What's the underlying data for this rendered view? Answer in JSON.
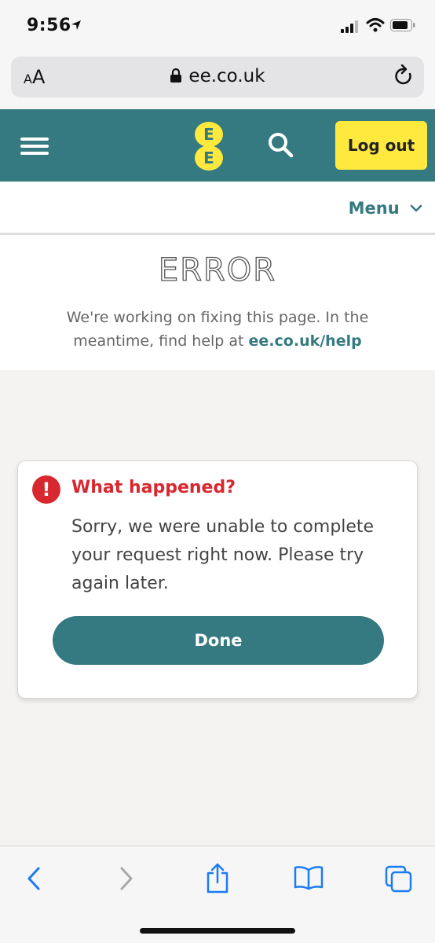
{
  "status_bar": {
    "time": "9:56"
  },
  "browser": {
    "text_size_label_big": "A",
    "text_size_label_small": "A",
    "url": "ee.co.uk"
  },
  "header": {
    "logo_letters": [
      "E",
      "E"
    ],
    "logout_label": "Log out"
  },
  "nav": {
    "menu_label": "Menu"
  },
  "error_page": {
    "title": "ERROR",
    "description_prefix": "We're working on fixing this page. In the meantime, find help at",
    "help_link": "ee.co.uk/help"
  },
  "dialog": {
    "icon_glyph": "!",
    "title": "What happened?",
    "message": "Sorry, we were unable to complete your request right now. Please try again later.",
    "done_label": "Done"
  },
  "colors": {
    "brand_teal": "#357a80",
    "brand_yellow": "#ffe93f",
    "error_red": "#d8282f",
    "ios_blue": "#1a7cf5"
  },
  "icons": [
    "location-arrow-icon",
    "signal-icon",
    "wifi-icon",
    "battery-icon",
    "lock-icon",
    "reload-icon",
    "hamburger-icon",
    "search-icon",
    "chevron-down-icon",
    "alert-icon",
    "back-icon",
    "forward-icon",
    "share-icon",
    "bookmarks-icon",
    "tabs-icon"
  ]
}
